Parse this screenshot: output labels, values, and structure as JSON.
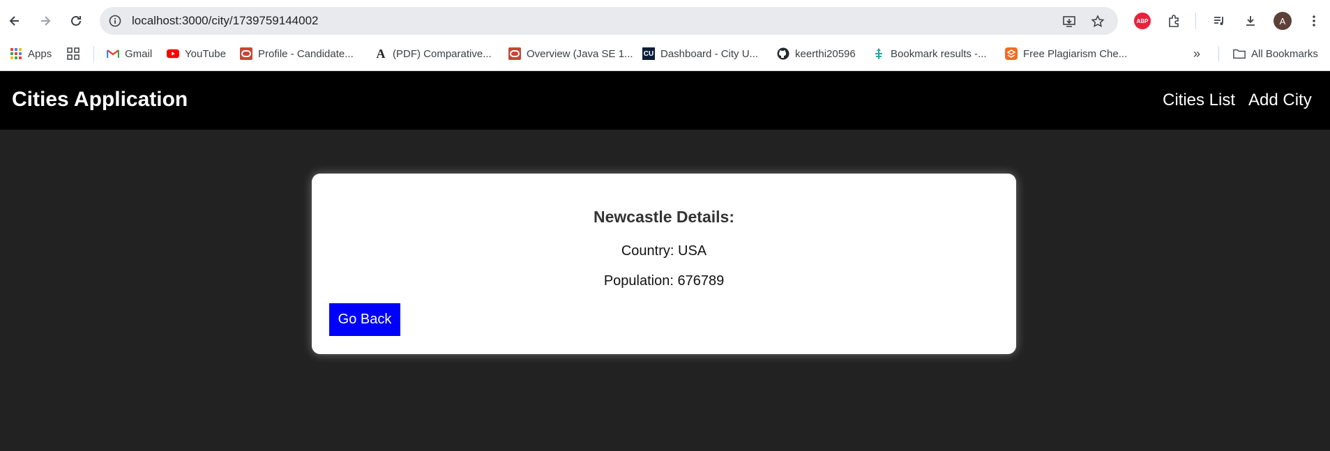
{
  "browser": {
    "url": "localhost:3000/city/1739759144002",
    "profile_initial": "A",
    "extension_badge": "ABP"
  },
  "bookmarks": {
    "items": [
      {
        "label": "Apps",
        "icon": "apps-grid-icon"
      },
      {
        "label": "",
        "icon": "grid-icon"
      },
      {
        "label": "Gmail",
        "icon": "gmail-icon"
      },
      {
        "label": "YouTube",
        "icon": "youtube-icon"
      },
      {
        "label": "Profile - Candidate...",
        "icon": "oracle-icon"
      },
      {
        "label": "(PDF) Comparative...",
        "icon": "academia-icon"
      },
      {
        "label": "Overview (Java SE 1...",
        "icon": "oracle-icon"
      },
      {
        "label": "Dashboard - City U...",
        "icon": "cu-icon"
      },
      {
        "label": "keerthi20596",
        "icon": "github-icon"
      },
      {
        "label": "Bookmark results -...",
        "icon": "bookmark-results-icon"
      },
      {
        "label": "Free Plagiarism Che...",
        "icon": "plagiarism-icon"
      }
    ],
    "all_bookmarks": "All Bookmarks",
    "overflow": "»"
  },
  "app": {
    "title": "Cities Application",
    "nav": {
      "cities_list": "Cities List",
      "add_city": "Add City"
    }
  },
  "city": {
    "heading": "Newcastle Details:",
    "country_line": "Country: USA",
    "population_line": "Population: 676789",
    "go_back_label": "Go Back"
  },
  "colors": {
    "page_bg": "#222222",
    "header_bg": "#000000",
    "button_bg": "#0000ff"
  }
}
